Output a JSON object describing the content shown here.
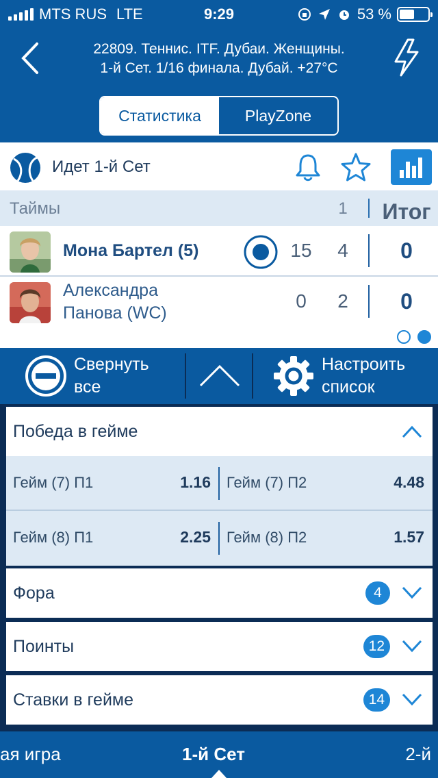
{
  "status_bar": {
    "carrier": "MTS RUS",
    "network": "LTE",
    "time": "9:29",
    "battery": "53 %",
    "battery_level": 0.53
  },
  "header": {
    "title_line1": "22809. Теннис. ITF. Дубаи. Женщины.",
    "title_line2": "1-й  Сет. 1/16 финала. Дубай. +27°C",
    "tabs": [
      {
        "label": "Статистика",
        "active": true
      },
      {
        "label": "PlayZone",
        "active": false
      }
    ]
  },
  "match": {
    "status": "Идет 1-й  Сет",
    "table_header": {
      "label": "Таймы",
      "set1": "1",
      "total": "Итог"
    },
    "players": [
      {
        "name": "Мона Бартел (5)",
        "serving": true,
        "points": "15",
        "set1": "4",
        "total": "0"
      },
      {
        "name_line1": "Александра",
        "name_line2": "Панова (WC)",
        "serving": false,
        "points": "0",
        "set1": "2",
        "total": "0"
      }
    ],
    "page_indicator": {
      "count": 2,
      "active": 2
    }
  },
  "actions": {
    "collapse_line1": "Свернуть",
    "collapse_line2": "все",
    "configure_line1": "Настроить",
    "configure_line2": "список"
  },
  "markets": [
    {
      "title": "Победа в гейме",
      "expanded": true,
      "odds": [
        [
          {
            "name": "Гейм (7) П1",
            "value": "1.16"
          },
          {
            "name": "Гейм (7) П2",
            "value": "4.48"
          }
        ],
        [
          {
            "name": "Гейм (8) П1",
            "value": "2.25"
          },
          {
            "name": "Гейм (8) П2",
            "value": "1.57"
          }
        ]
      ]
    },
    {
      "title": "Фора",
      "count": "4",
      "expanded": false
    },
    {
      "title": "Поинты",
      "count": "12",
      "expanded": false
    },
    {
      "title": "Ставки в гейме",
      "count": "14",
      "expanded": false
    }
  ],
  "bottom_tabs": [
    {
      "label": "ая игра",
      "active": false
    },
    {
      "label": "1-й  Сет",
      "active": true
    },
    {
      "label": "2-й",
      "active": false
    }
  ],
  "colors": {
    "primary": "#0a5aa0",
    "accent": "#1e86d6",
    "dark": "#0b2c55",
    "light_row": "#dde9f4"
  }
}
